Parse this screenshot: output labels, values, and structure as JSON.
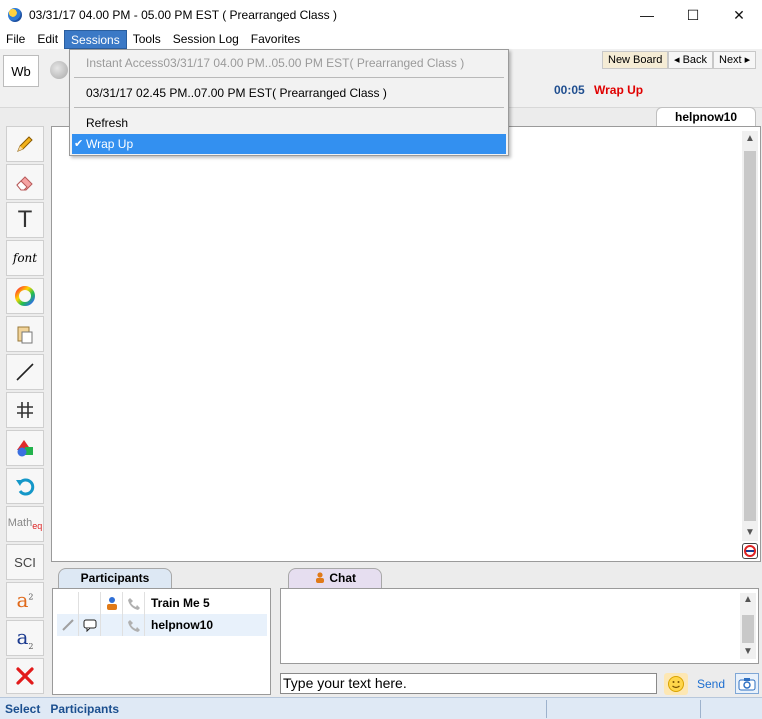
{
  "window": {
    "title": "03/31/17 04.00 PM - 05.00 PM EST ( Prearranged Class )",
    "controls": {
      "minimize": "—",
      "maximize": "☐",
      "close": "✕"
    }
  },
  "menubar": {
    "items": [
      "File",
      "Edit",
      "Sessions",
      "Tools",
      "Session Log",
      "Favorites"
    ],
    "active": "Sessions"
  },
  "sessions_menu": {
    "items": [
      {
        "label": "Instant Access03/31/17 04.00 PM..05.00 PM EST( Prearranged Class )",
        "enabled": false
      },
      {
        "label": "03/31/17 02.45 PM..07.00 PM EST( Prearranged Class )",
        "enabled": true
      },
      {
        "label": "Refresh",
        "enabled": true
      },
      {
        "label": "Wrap Up",
        "enabled": true,
        "checked": true,
        "highlighted": true
      }
    ],
    "check_mark": "✔"
  },
  "toolbar": {
    "wb_tab": "Wb",
    "new_board": "New Board",
    "back": "◂ Back",
    "next": "Next ▸",
    "timer": "00:05",
    "status": "Wrap Up"
  },
  "board": {
    "tab_label": "helpnow10"
  },
  "tools": [
    {
      "name": "pencil-icon"
    },
    {
      "name": "eraser-icon"
    },
    {
      "name": "text-icon",
      "glyph": "T"
    },
    {
      "name": "font-icon",
      "glyph": "font"
    },
    {
      "name": "color-wheel-icon"
    },
    {
      "name": "paste-icon"
    },
    {
      "name": "line-icon"
    },
    {
      "name": "grid-icon"
    },
    {
      "name": "shapes-icon"
    },
    {
      "name": "undo-icon"
    },
    {
      "name": "math-eq-icon",
      "glyph": "Math",
      "sub": "eq"
    },
    {
      "name": "sci-icon",
      "glyph": "SCI"
    },
    {
      "name": "superscript-icon",
      "glyph": "a",
      "sub": "2"
    },
    {
      "name": "subscript-icon",
      "glyph": "a",
      "sub": "2"
    },
    {
      "name": "clear-icon"
    }
  ],
  "participants": {
    "tab_label": "Participants",
    "rows": [
      {
        "name": "Train Me 5"
      },
      {
        "name": "helpnow10"
      }
    ]
  },
  "chat": {
    "tab_label": "Chat",
    "input_value": "Type your text here.",
    "send_label": "Send"
  },
  "statusbar": {
    "select": "Select",
    "participants": "Participants"
  },
  "colors": {
    "accent": "#3390f0",
    "status_red": "#e00000",
    "timer_blue": "#1f4e8f",
    "menu_active": "#3b79c6"
  }
}
